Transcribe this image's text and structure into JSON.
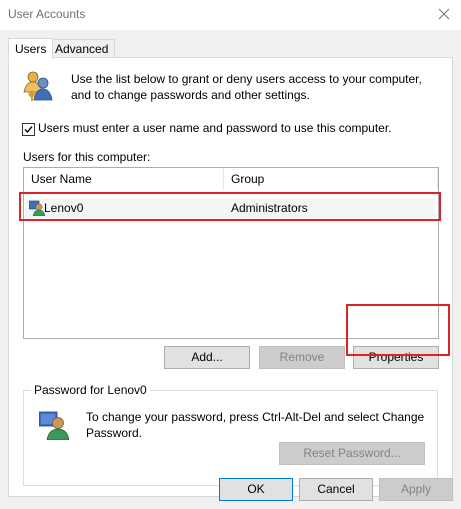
{
  "window": {
    "title": "User Accounts",
    "close_label": "Close"
  },
  "tabs": [
    {
      "label": "Users",
      "active": true
    },
    {
      "label": "Advanced",
      "active": false
    }
  ],
  "users_tab": {
    "description": "Use the list below to grant or deny users access to your computer, and to change passwords and other settings.",
    "require_login_label": "Users must enter a user name and password to use this computer.",
    "require_login_checked": true,
    "users_list_label": "Users for this computer:",
    "columns": [
      "User Name",
      "Group"
    ],
    "rows": [
      {
        "user_name": "Lenov0",
        "group": "Administrators"
      }
    ],
    "buttons": {
      "add": "Add...",
      "remove": "Remove",
      "properties": "Properties"
    },
    "password_group": {
      "title": "Password for Lenov0",
      "text": "To change your password, press Ctrl-Alt-Del and select Change Password.",
      "reset_button": "Reset Password..."
    }
  },
  "footer": {
    "ok": "OK",
    "cancel": "Cancel",
    "apply": "Apply"
  },
  "colors": {
    "highlight": "#d9252a",
    "default_button_border": "#0078d7"
  }
}
